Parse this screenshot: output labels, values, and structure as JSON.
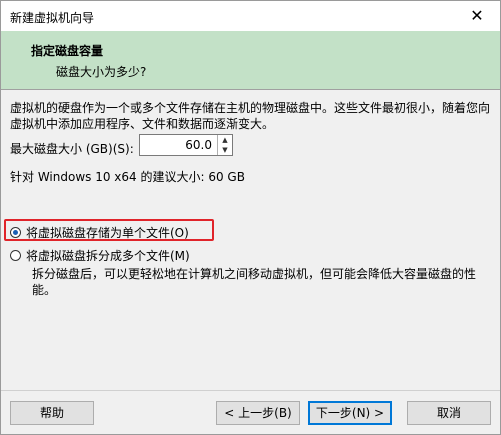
{
  "window": {
    "title": "新建虚拟机向导",
    "close": "✕"
  },
  "header": {
    "title": "指定磁盘容量",
    "subtitle": "磁盘大小为多少?"
  },
  "main": {
    "description": "虚拟机的硬盘作为一个或多个文件存储在主机的物理磁盘中。这些文件最初很小，随着您向虚拟机中添加应用程序、文件和数据而逐渐变大。",
    "max_size_label": "最大磁盘大小 (GB)(S):",
    "max_size_value": "60.0",
    "recommended": "针对 Windows 10 x64 的建议大小: 60 GB",
    "option_single": "将虚拟磁盘存储为单个文件(O)",
    "option_split": "将虚拟磁盘拆分成多个文件(M)",
    "split_note": "拆分磁盘后，可以更轻松地在计算机之间移动虚拟机，但可能会降低大容量磁盘的性能。"
  },
  "footer": {
    "help": "帮助",
    "back": "< 上一步(B)",
    "next": "下一步(N) >",
    "cancel": "取消"
  },
  "colors": {
    "header_bg": "#c3e1c7",
    "highlight": "#e0242a",
    "accent": "#0078d7"
  }
}
